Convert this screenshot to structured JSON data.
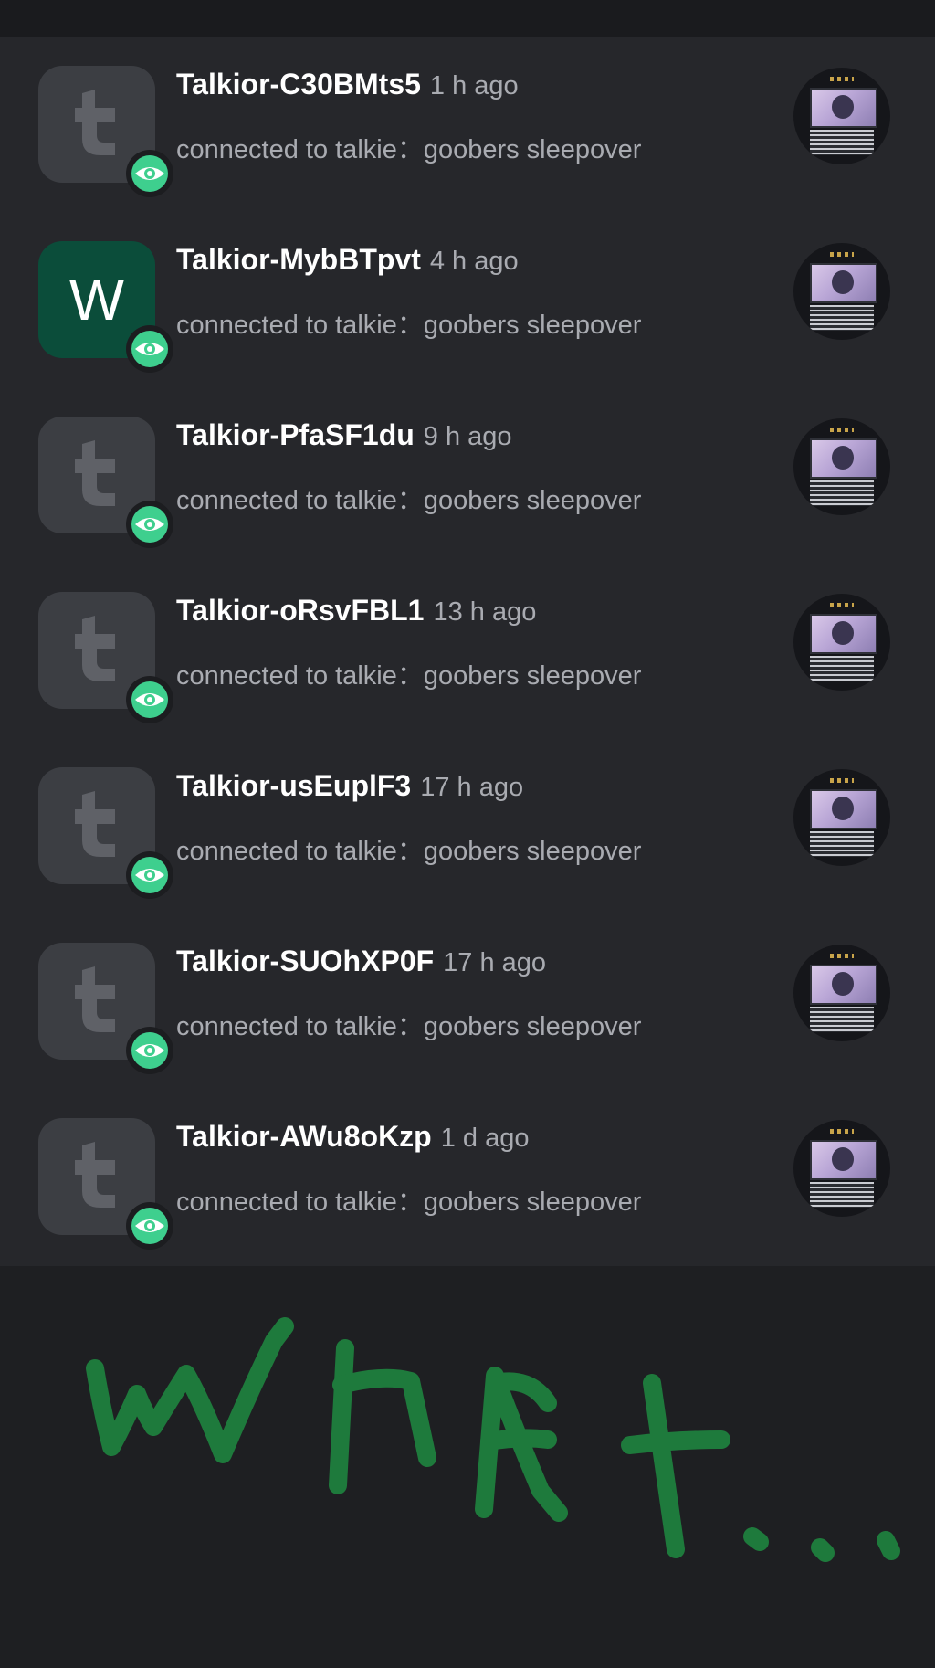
{
  "colors": {
    "background": "#1e1f22",
    "list_background": "#26272b",
    "avatar_default": "#3c3e43",
    "avatar_w": "#0b4d3a",
    "badge": "#3ecf8e",
    "ink": "#1e7a3c"
  },
  "notifications": [
    {
      "avatar": "talkior-logo",
      "name": "Talkior-C30BMts5",
      "time": "1 h ago",
      "message": "connected to talkie：goobers sleepover"
    },
    {
      "avatar": "letter",
      "avatar_letter": "W",
      "name": "Talkior-MybBTpvt",
      "time": "4 h ago",
      "message": "connected to talkie：goobers sleepover"
    },
    {
      "avatar": "talkior-logo",
      "name": "Talkior-PfaSF1du",
      "time": "9 h ago",
      "message": "connected to talkie：goobers sleepover"
    },
    {
      "avatar": "talkior-logo",
      "name": "Talkior-oRsvFBL1",
      "time": "13 h ago",
      "message": "connected to talkie：goobers sleepover"
    },
    {
      "avatar": "talkior-logo",
      "name": "Talkior-usEuplF3",
      "time": "17 h ago",
      "message": "connected to talkie：goobers sleepover"
    },
    {
      "avatar": "talkior-logo",
      "name": "Talkior-SUOhXP0F",
      "time": "17 h ago",
      "message": "connected to talkie：goobers sleepover"
    },
    {
      "avatar": "talkior-logo",
      "name": "Talkior-AWu8oKzp",
      "time": "1 d ago",
      "message": "connected to talkie：goobers sleepover"
    }
  ],
  "handwriting": "what..."
}
